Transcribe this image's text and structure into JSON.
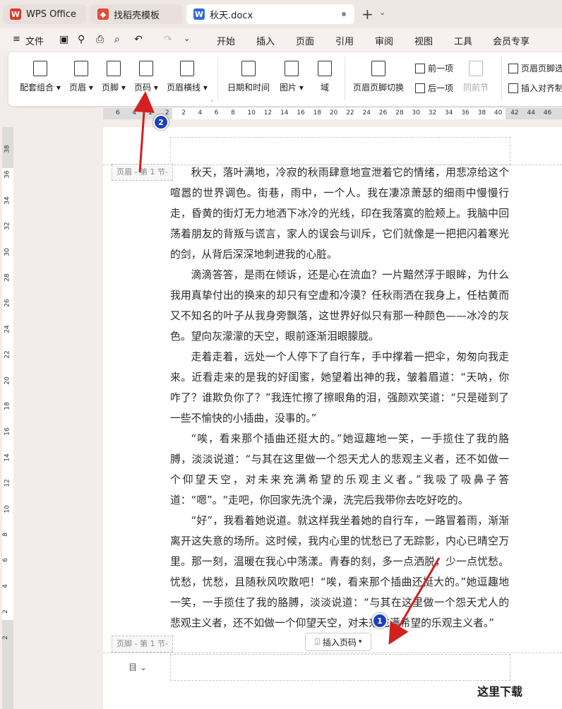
{
  "tabs": [
    {
      "label": "WPS Office",
      "icon": "wps-logo-icon"
    },
    {
      "label": "找稻壳模板",
      "icon": "docer-icon"
    },
    {
      "label": "秋天.docx",
      "icon": "word-doc-icon"
    }
  ],
  "menu": {
    "file": "文件",
    "items": [
      "开始",
      "插入",
      "页面",
      "引用",
      "审阅",
      "视图",
      "工具",
      "会员专享"
    ]
  },
  "ribbon": {
    "combo": "配套组合",
    "header": "页眉",
    "footer": "页脚",
    "page_number": "页码",
    "header_line": "页眉横线",
    "date_time": "日期和时间",
    "picture": "图片",
    "field": "域",
    "switch": "页眉页脚切换",
    "prev": "前一项",
    "next": "后一项",
    "same_as_prev": "同前节",
    "header_footer_options": "页眉页脚选",
    "insert_align_tab": "插入对齐制"
  },
  "ruler": {
    "h": [
      "6",
      "4",
      "2",
      "2",
      "2",
      "4",
      "6",
      "8",
      "10",
      "12",
      "14",
      "16",
      "18",
      "20",
      "22",
      "24",
      "26",
      "28",
      "30",
      "32",
      "34",
      "36",
      "38",
      "40",
      "42",
      "44",
      "46"
    ],
    "v": [
      "38",
      "36",
      "34",
      "32",
      "30",
      "28",
      "26",
      "24",
      "22",
      "20",
      "18",
      "16",
      "14",
      "12",
      "10",
      "8",
      "6",
      "4",
      "2",
      "2"
    ]
  },
  "header_tag": "页眉 - 第 1 节-",
  "footer_tag": "页脚 - 第 1 节-",
  "insert_page_number": "插入页码",
  "paragraphs": [
    "秋天，落叶满地，冷寂的秋雨肆意地宣泄着它的情绪，用悲凉给这个喧嚣的世界调色。街巷，雨中，一个人。我在凄凉萧瑟的细雨中慢慢行走，昏黄的街灯无力地洒下冰冷的光线，印在我落寞的脸颊上。我脑中回荡着朋友的背叛与谎言，家人的误会与训斥，它们就像是一把把闪着寒光的剑，从背后深深地刺进我的心脏。",
    "滴滴答答，是雨在倾诉，还是心在流血？一片黯然浮于眼眸，为什么我用真挚付出的换来的却只有空虚和冷漠？任秋雨洒在我身上，任枯黄而又不知名的叶子从我身旁飘落，这世界好似只有那一种颜色——冰冷的灰色。望向灰濛濛的天空，眼前逐渐泪眼朦胧。",
    "走着走着，远处一个人停下了自行车，手中撑着一把伞，匆匆向我走来。近看走来的是我的好闺蜜，她望着出神的我，皱着眉道：“天呐，你咋了？谁欺负你了？”我连忙擦了擦眼角的泪，强颜欢笑道：“只是碰到了一些不愉快的小插曲，没事的。”",
    "“唉，看来那个插曲还挺大的。”她逗趣地一笑，一手揽住了我的胳膊，淡淡说道：“与其在这里做一个怨天尤人的悲观主义者，还不如做一个仰望天空，对未来充满希望的乐观主义者。”我吸了吸鼻子答道：“嗯”。“走吧，你回家先洗个澡，洗完后我带你去吃好吃的。",
    "“好”，我看着她说道。就这样我坐着她的自行车，一路冒着雨，渐渐离开这失意的场所。这时候，我内心里的忧愁已了无踪影，内心已晴空万里。那一刻，温暖在我心中荡漾。青春的刻，多一点洒脱，少一点忧愁。忧愁，忧愁，且随秋风吹散吧！“唉，看来那个插曲还挺大的。”她逗趣地一笑，一手揽住了我的胳膊，淡淡说道：“与其在这里做一个怨天尤人的悲观主义者，还不如做一个仰望天空，对未来充满希望的乐观主义者。”"
  ],
  "badges": [
    "1",
    "2"
  ],
  "watermark": "这里下载"
}
